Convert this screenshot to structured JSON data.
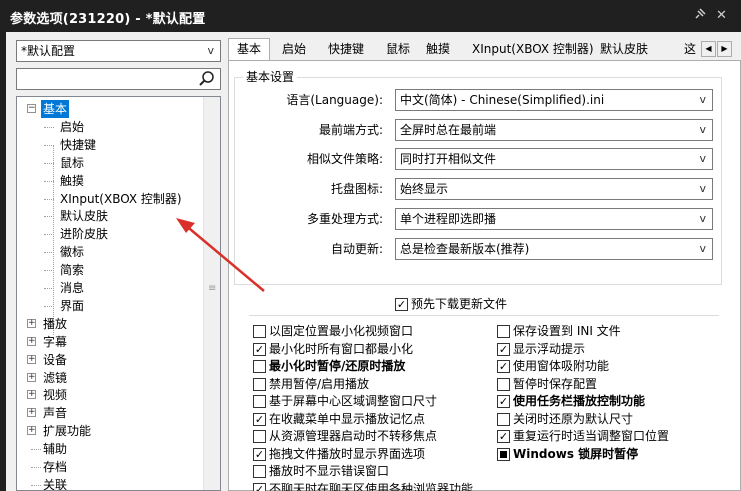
{
  "window": {
    "title": "参数选项(231220) - *默认配置",
    "pin_glyph": "✕",
    "close_glyph": "✕"
  },
  "preset": {
    "value": "*默认配置",
    "arrow": "v"
  },
  "search": {
    "value": "",
    "placeholder": ""
  },
  "tree": {
    "items": [
      {
        "label": "基本",
        "expander": "−",
        "selected": true
      },
      {
        "label": "启始"
      },
      {
        "label": "快捷键"
      },
      {
        "label": "鼠标"
      },
      {
        "label": "触摸"
      },
      {
        "label": "XInput(XBOX 控制器)"
      },
      {
        "label": "默认皮肤"
      },
      {
        "label": "进阶皮肤"
      },
      {
        "label": "徽标"
      },
      {
        "label": "简索"
      },
      {
        "label": "消息"
      },
      {
        "label": "界面"
      },
      {
        "label": "播放",
        "expander": "+"
      },
      {
        "label": "字幕",
        "expander": "+"
      },
      {
        "label": "设备",
        "expander": "+"
      },
      {
        "label": "滤镜",
        "expander": "+"
      },
      {
        "label": "视频",
        "expander": "+"
      },
      {
        "label": "声音",
        "expander": "+"
      },
      {
        "label": "扩展功能",
        "expander": "+"
      },
      {
        "label": "辅助"
      },
      {
        "label": "存档"
      },
      {
        "label": "关联"
      }
    ]
  },
  "tabs": [
    "基本",
    "启始",
    "快捷键",
    "鼠标",
    "触摸",
    "XInput(XBOX 控制器)",
    "默认皮肤",
    "这"
  ],
  "tab_scroll": {
    "left": "◀",
    "right": "▶"
  },
  "basic": {
    "legend": "基本设置",
    "fields": [
      {
        "label": "语言(Language):",
        "value": "中文(简体) - Chinese(Simplified).ini"
      },
      {
        "label": "最前端方式:",
        "value": "全屏时总在最前端"
      },
      {
        "label": "相似文件策略:",
        "value": "同时打开相似文件"
      },
      {
        "label": "托盘图标:",
        "value": "始终显示"
      },
      {
        "label": "多重处理方式:",
        "value": "单个进程即选即播"
      },
      {
        "label": "自动更新:",
        "value": "总是检查最新版本(推荐)"
      }
    ],
    "combo_arrow": "v",
    "predownload": {
      "label": "预先下载更新文件",
      "checked": true
    }
  },
  "options_left": [
    {
      "label": "以固定位置最小化视频窗口",
      "state": "unchecked"
    },
    {
      "label": "最小化时所有窗口都最小化",
      "state": "checked"
    },
    {
      "label": "最小化时暂停/还原时播放",
      "state": "unchecked",
      "bold": true
    },
    {
      "label": "禁用暂停/启用播放",
      "state": "unchecked"
    },
    {
      "label": "基于屏幕中心区域调整窗口尺寸",
      "state": "unchecked"
    },
    {
      "label": "在收藏菜单中显示播放记忆点",
      "state": "checked"
    },
    {
      "label": "从资源管理器启动时不转移焦点",
      "state": "unchecked"
    },
    {
      "label": "拖拽文件播放时显示界面选项",
      "state": "checked"
    },
    {
      "label": "播放时不显示错误窗口",
      "state": "unchecked"
    },
    {
      "label": "不聊天时在聊天区使用各种浏览器功能",
      "state": "checked"
    }
  ],
  "options_right": [
    {
      "label": "保存设置到 INI 文件",
      "state": "unchecked"
    },
    {
      "label": "显示浮动提示",
      "state": "checked"
    },
    {
      "label": "使用窗体吸附功能",
      "state": "checked"
    },
    {
      "label": "暂停时保存配置",
      "state": "unchecked"
    },
    {
      "label": "使用任务栏播放控制功能",
      "state": "checked",
      "bold": true
    },
    {
      "label": "关闭时还原为默认尺寸",
      "state": "unchecked"
    },
    {
      "label": "重复运行时适当调整窗口位置",
      "state": "checked"
    },
    {
      "label": "Windows 锁屏时暂停",
      "state": "indeterminate",
      "bold": true
    }
  ],
  "colors": {
    "selection": "#0078d7",
    "annotation_arrow": "#d9302a",
    "titlebar": "#202020"
  }
}
